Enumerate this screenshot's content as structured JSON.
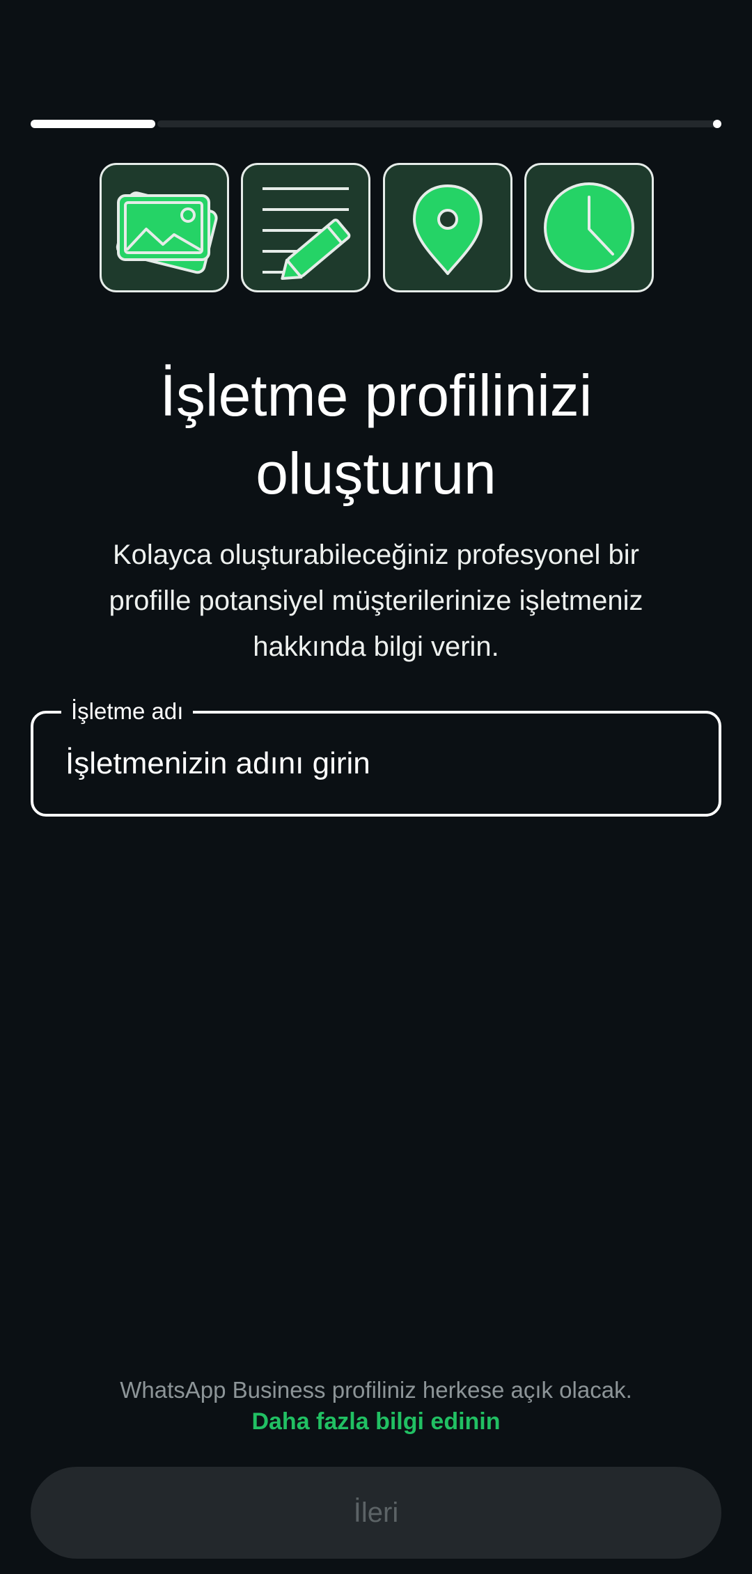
{
  "onboarding": {
    "progress_fraction": 0.18,
    "steps": [
      {
        "icon": "image-icon"
      },
      {
        "icon": "pencil-note-icon"
      },
      {
        "icon": "location-pin-icon"
      },
      {
        "icon": "clock-icon"
      }
    ],
    "title": "İşletme profilinizi oluşturun",
    "subtitle": "Kolayca oluşturabileceğiniz profesyonel bir profille potansiyel müşterilerinize işletmeniz hakkında bilgi verin."
  },
  "business_name_field": {
    "label": "İşletme adı",
    "placeholder": "İşletmenizin adını girin",
    "value": ""
  },
  "footer": {
    "note": "WhatsApp Business profiliniz herkese açık olacak.",
    "link": "Daha fazla bilgi edinin"
  },
  "next_button": {
    "label": "İleri",
    "enabled": false
  },
  "colors": {
    "background": "#0b1014",
    "accent": "#21c063",
    "tile_fill": "#1e3a2c",
    "disabled_button": "#23282c"
  }
}
